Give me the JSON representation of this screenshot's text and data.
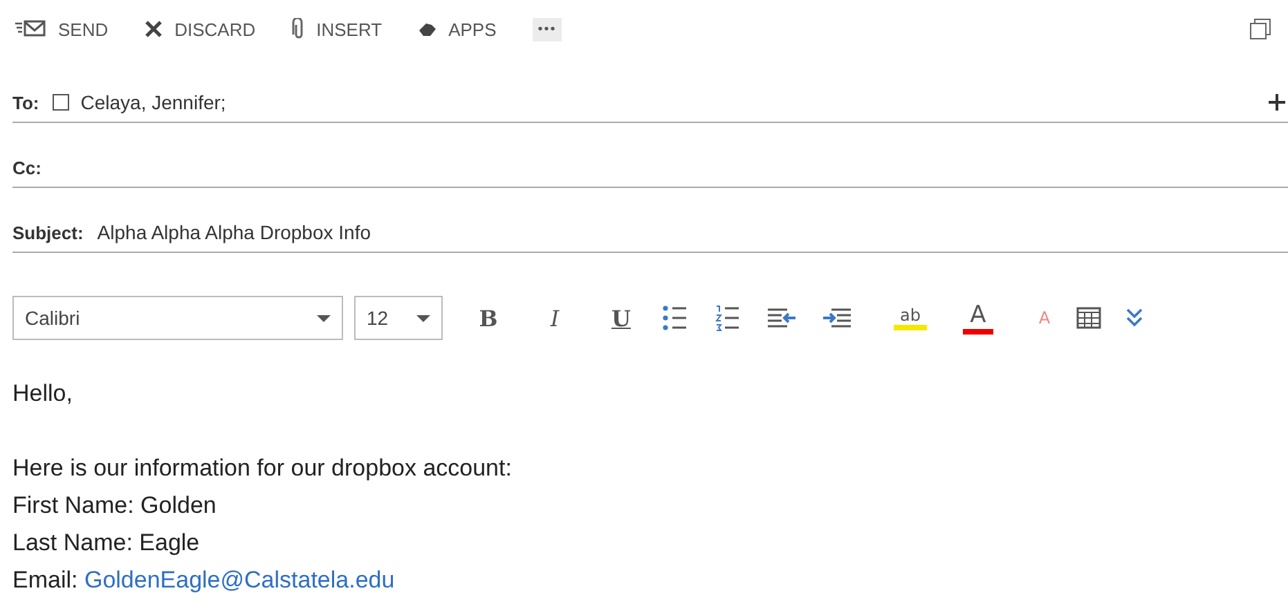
{
  "toolbar": [
    {
      "kind": "send",
      "label": "SEND"
    },
    {
      "kind": "discard",
      "label": "DISCARD"
    },
    {
      "kind": "insert",
      "label": "INSERT"
    },
    {
      "kind": "apps",
      "label": "APPS"
    },
    {
      "kind": "more",
      "label": "•••"
    }
  ],
  "fields": [
    {
      "label": "To:",
      "recipients": [
        "Celaya, Jennifer;"
      ]
    },
    {
      "label": "Cc:"
    },
    {
      "label": "Subject:",
      "value": "Alpha Alpha Alpha Dropbox Info"
    }
  ],
  "format_bar": {
    "font": "Calibri",
    "size": "12",
    "tools": [
      {
        "kind": "bold",
        "glyph": "B"
      },
      {
        "kind": "italic",
        "glyph": "I"
      },
      {
        "kind": "underline",
        "glyph": "U"
      },
      {
        "kind": "bullets"
      },
      {
        "kind": "numbering"
      },
      {
        "kind": "outdent"
      },
      {
        "kind": "indent"
      },
      {
        "kind": "highlight",
        "glyph": "ab"
      },
      {
        "kind": "fontcolor",
        "glyph": "A"
      },
      {
        "kind": "clear",
        "glyph": "A"
      },
      {
        "kind": "table"
      },
      {
        "kind": "expand"
      }
    ]
  },
  "body": [
    [
      {
        "text": "Hello,"
      }
    ],
    [
      {
        "text": "Here is our information for our dropbox account:"
      },
      {
        "text": "First Name: Golden"
      },
      {
        "text": "Last Name: Eagle"
      },
      {
        "text": "Email: ",
        "link": "GoldenEagle@Calstatela.edu"
      }
    ]
  ]
}
